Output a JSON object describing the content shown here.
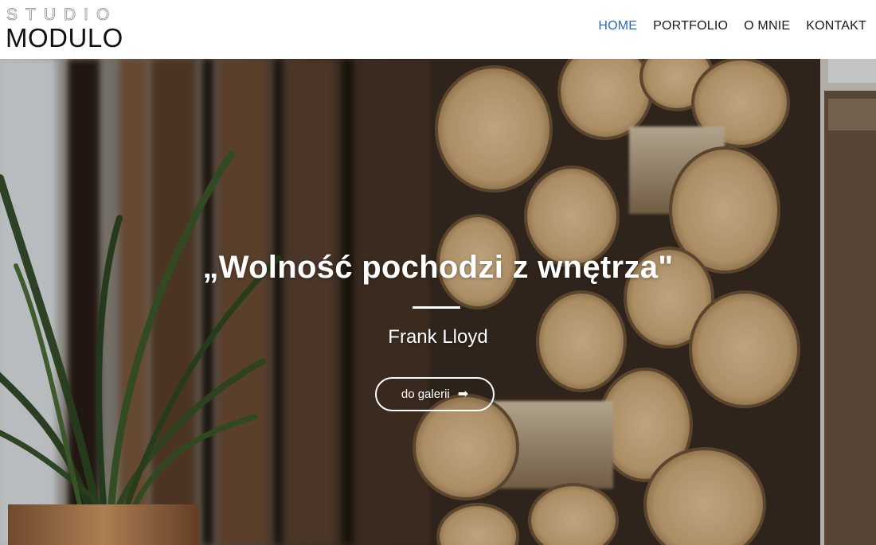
{
  "header": {
    "logo": {
      "top": "STUDIO",
      "bottom": "MODULO"
    },
    "nav": [
      {
        "label": "HOME",
        "active": true
      },
      {
        "label": "PORTFOLIO",
        "active": false
      },
      {
        "label": "O MNIE",
        "active": false
      },
      {
        "label": "KONTAKT",
        "active": false
      }
    ],
    "active_color": "#2c6bb0"
  },
  "hero": {
    "quote": "„Wolność pochodzi z wnętrza\"",
    "author": "Frank Lloyd",
    "button": {
      "label": "do galerii",
      "icon": "arrow-right-icon"
    }
  }
}
